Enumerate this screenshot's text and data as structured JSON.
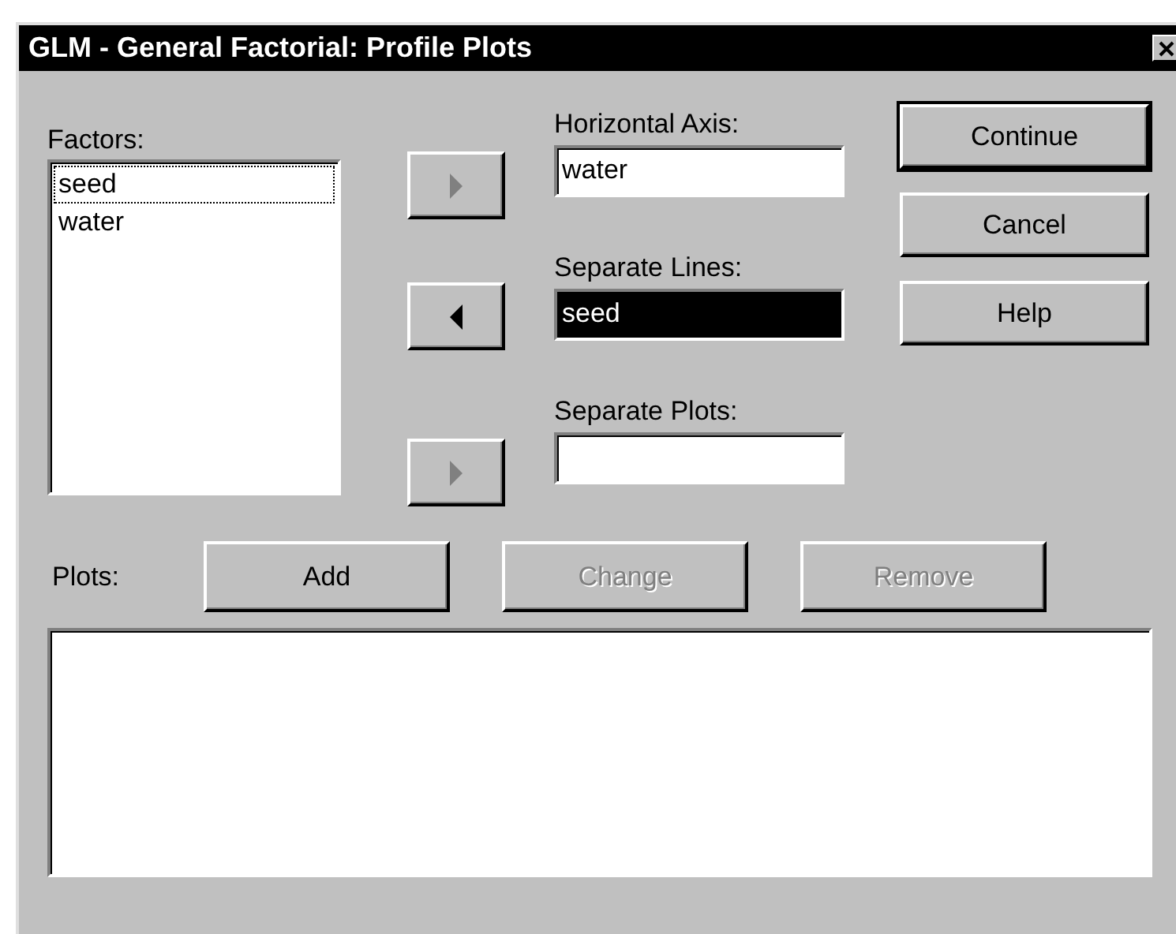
{
  "window": {
    "title": "GLM - General Factorial: Profile Plots"
  },
  "factors": {
    "label": "Factors:",
    "items": [
      {
        "text": "seed",
        "focused": true
      },
      {
        "text": "water",
        "focused": false
      }
    ]
  },
  "arrow_buttons": [
    {
      "kind": "right",
      "disabled": true
    },
    {
      "kind": "left",
      "disabled": false
    },
    {
      "kind": "right",
      "disabled": true
    }
  ],
  "fields": [
    {
      "label": "Horizontal Axis:",
      "value": "water",
      "selected": false
    },
    {
      "label": "Separate Lines:",
      "value": "seed",
      "selected": true
    },
    {
      "label": "Separate Plots:",
      "selected": false
    }
  ],
  "buttons": [
    {
      "label": "Continue",
      "default": true
    },
    {
      "label": "Cancel",
      "default": false
    },
    {
      "label": "Help",
      "default": false
    }
  ],
  "plots": {
    "label": "Plots:",
    "buttons": [
      {
        "label": "Add",
        "disabled": false
      },
      {
        "label": "Change",
        "disabled": true
      },
      {
        "label": "Remove",
        "disabled": true
      }
    ]
  }
}
